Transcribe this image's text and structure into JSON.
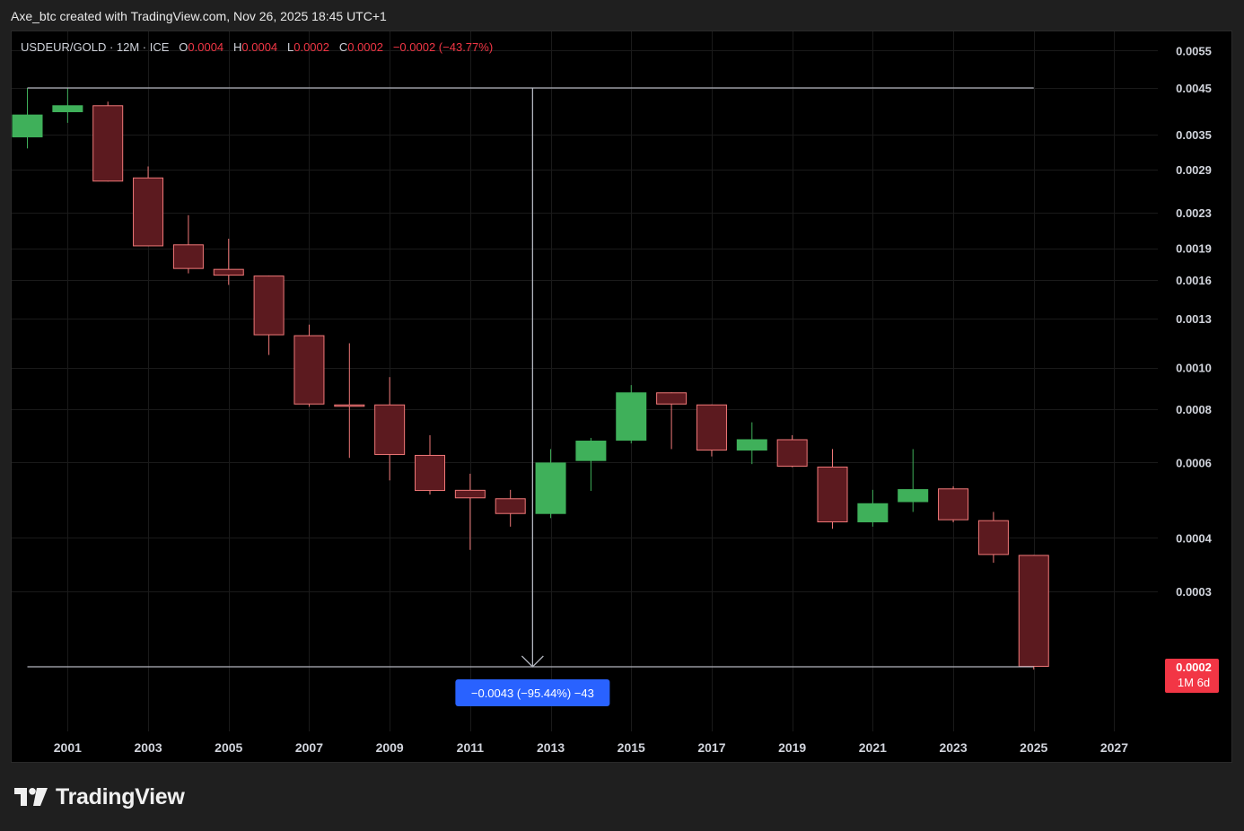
{
  "header": {
    "caption": "Axe_btc created with TradingView.com, Nov 26, 2025 18:45 UTC+1"
  },
  "legend": {
    "symbol": "USDEUR/GOLD · 12M · ICE",
    "o_label": "O",
    "o_value": "0.0004",
    "h_label": "H",
    "h_value": "0.0004",
    "l_label": "L",
    "l_value": "0.0002",
    "c_label": "C",
    "c_value": "0.0002",
    "change": "−0.0002 (−43.77%)"
  },
  "brand": {
    "name": "TradingView"
  },
  "colors": {
    "up": "#3fb05a",
    "down": "#5c1a1f",
    "down_wick": "#f07878",
    "up_wick": "#3fb05a",
    "measure": "#b2b5be",
    "measure_label_bg": "#2962ff",
    "price_tag_bg": "#f23645"
  },
  "chart_data": {
    "type": "candlestick",
    "scale": "log",
    "x_tick_labels": [
      "2001",
      "2003",
      "2005",
      "2007",
      "2009",
      "2011",
      "2013",
      "2015",
      "2017",
      "2019",
      "2021",
      "2023",
      "2025",
      "2027"
    ],
    "y_tick_labels": [
      "0.0055",
      "0.0045",
      "0.0035",
      "0.0029",
      "0.0023",
      "0.0019",
      "0.0016",
      "0.0013",
      "0.0010",
      "0.0008",
      "0.0006",
      "0.0004",
      "0.0003"
    ],
    "y_ticks": [
      0.0055,
      0.0045,
      0.0035,
      0.0029,
      0.0023,
      0.0019,
      0.0016,
      0.0013,
      0.001,
      0.0008,
      0.0006,
      0.0004,
      0.0003
    ],
    "candles": [
      {
        "year": 2000,
        "open": 0.00345,
        "high": 0.0045,
        "low": 0.00325,
        "close": 0.0039
      },
      {
        "year": 2001,
        "open": 0.00395,
        "high": 0.0045,
        "low": 0.00373,
        "close": 0.0041
      },
      {
        "year": 2002,
        "open": 0.0041,
        "high": 0.00418,
        "low": 0.00272,
        "close": 0.00272
      },
      {
        "year": 2003,
        "open": 0.00278,
        "high": 0.00295,
        "low": 0.00192,
        "close": 0.00192
      },
      {
        "year": 2004,
        "open": 0.00194,
        "high": 0.00227,
        "low": 0.00166,
        "close": 0.0017
      },
      {
        "year": 2005,
        "open": 0.0017,
        "high": 0.002,
        "low": 0.00156,
        "close": 0.00164
      },
      {
        "year": 2006,
        "open": 0.00164,
        "high": 0.00164,
        "low": 0.00107,
        "close": 0.00119
      },
      {
        "year": 2007,
        "open": 0.00119,
        "high": 0.00126,
        "low": 0.00081,
        "close": 0.00082
      },
      {
        "year": 2008,
        "open": 0.00082,
        "high": 0.00114,
        "low": 0.000615,
        "close": 0.00081
      },
      {
        "year": 2009,
        "open": 0.00082,
        "high": 0.00095,
        "low": 0.000545,
        "close": 0.000625
      },
      {
        "year": 2010,
        "open": 0.000625,
        "high": 0.000695,
        "low": 0.000505,
        "close": 0.000515
      },
      {
        "year": 2011,
        "open": 0.000518,
        "high": 0.000565,
        "low": 0.000375,
        "close": 0.000495
      },
      {
        "year": 2012,
        "open": 0.000495,
        "high": 0.000518,
        "low": 0.000425,
        "close": 0.000455
      },
      {
        "year": 2013,
        "open": 0.000455,
        "high": 0.000645,
        "low": 0.000445,
        "close": 0.0006
      },
      {
        "year": 2014,
        "open": 0.000605,
        "high": 0.000685,
        "low": 0.000515,
        "close": 0.000675
      },
      {
        "year": 2015,
        "open": 0.000675,
        "high": 0.00091,
        "low": 0.000665,
        "close": 0.000875
      },
      {
        "year": 2016,
        "open": 0.000875,
        "high": 0.000875,
        "low": 0.000645,
        "close": 0.00082
      },
      {
        "year": 2017,
        "open": 0.00082,
        "high": 0.00082,
        "low": 0.00062,
        "close": 0.00064
      },
      {
        "year": 2018,
        "open": 0.00064,
        "high": 0.000745,
        "low": 0.000595,
        "close": 0.00068
      },
      {
        "year": 2019,
        "open": 0.00068,
        "high": 0.000695,
        "low": 0.000585,
        "close": 0.000587
      },
      {
        "year": 2020,
        "open": 0.000587,
        "high": 0.000645,
        "low": 0.00042,
        "close": 0.000435
      },
      {
        "year": 2021,
        "open": 0.000435,
        "high": 0.000518,
        "low": 0.000425,
        "close": 0.000482
      },
      {
        "year": 2022,
        "open": 0.000485,
        "high": 0.000645,
        "low": 0.00046,
        "close": 0.00052
      },
      {
        "year": 2023,
        "open": 0.000522,
        "high": 0.000528,
        "low": 0.000435,
        "close": 0.00044
      },
      {
        "year": 2024,
        "open": 0.00044,
        "high": 0.00046,
        "low": 0.00035,
        "close": 0.000365
      },
      {
        "year": 2025,
        "open": 0.000365,
        "high": 0.000365,
        "low": 0.000197,
        "close": 0.0002
      }
    ],
    "measure": {
      "from_value": 0.0045,
      "to_value": 0.0002,
      "label": "−0.0043 (−95.44%) −43"
    },
    "last_price": {
      "value": "0.0002",
      "countdown": "1M 6d"
    }
  }
}
